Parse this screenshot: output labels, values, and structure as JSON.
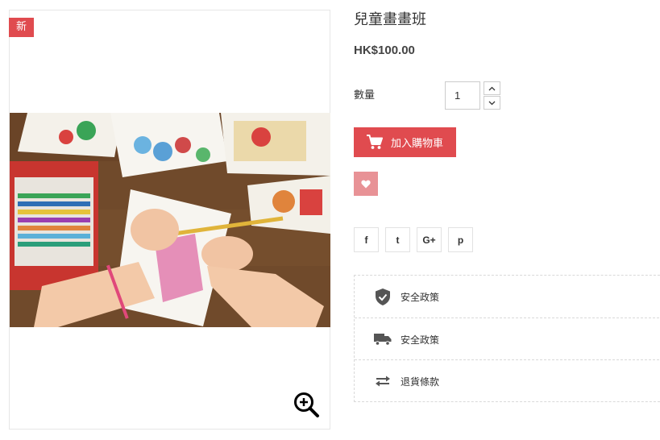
{
  "product": {
    "badge": "新",
    "title": "兒童畫畫班",
    "price": "HK$100.00",
    "image_alt": "children drawing with colored pencils"
  },
  "quantity": {
    "label": "數量",
    "value": "1"
  },
  "actions": {
    "add_to_cart_label": "加入購物車",
    "add_to_cart_icon": "cart-icon",
    "wishlist_icon": "heart-icon"
  },
  "share": {
    "items": [
      {
        "name": "facebook",
        "glyph": "f"
      },
      {
        "name": "twitter",
        "glyph": "t"
      },
      {
        "name": "google-plus",
        "glyph": "G+"
      },
      {
        "name": "pinterest",
        "glyph": "p"
      }
    ]
  },
  "policies": {
    "items": [
      {
        "icon": "shield-check-icon",
        "label": "安全政策"
      },
      {
        "icon": "truck-icon",
        "label": "安全政策"
      },
      {
        "icon": "exchange-icon",
        "label": "退貨條款"
      }
    ]
  },
  "colors": {
    "accent": "#e04b4f",
    "wishlist": "#e89296",
    "border": "#e6e6e6",
    "text": "#333333"
  }
}
